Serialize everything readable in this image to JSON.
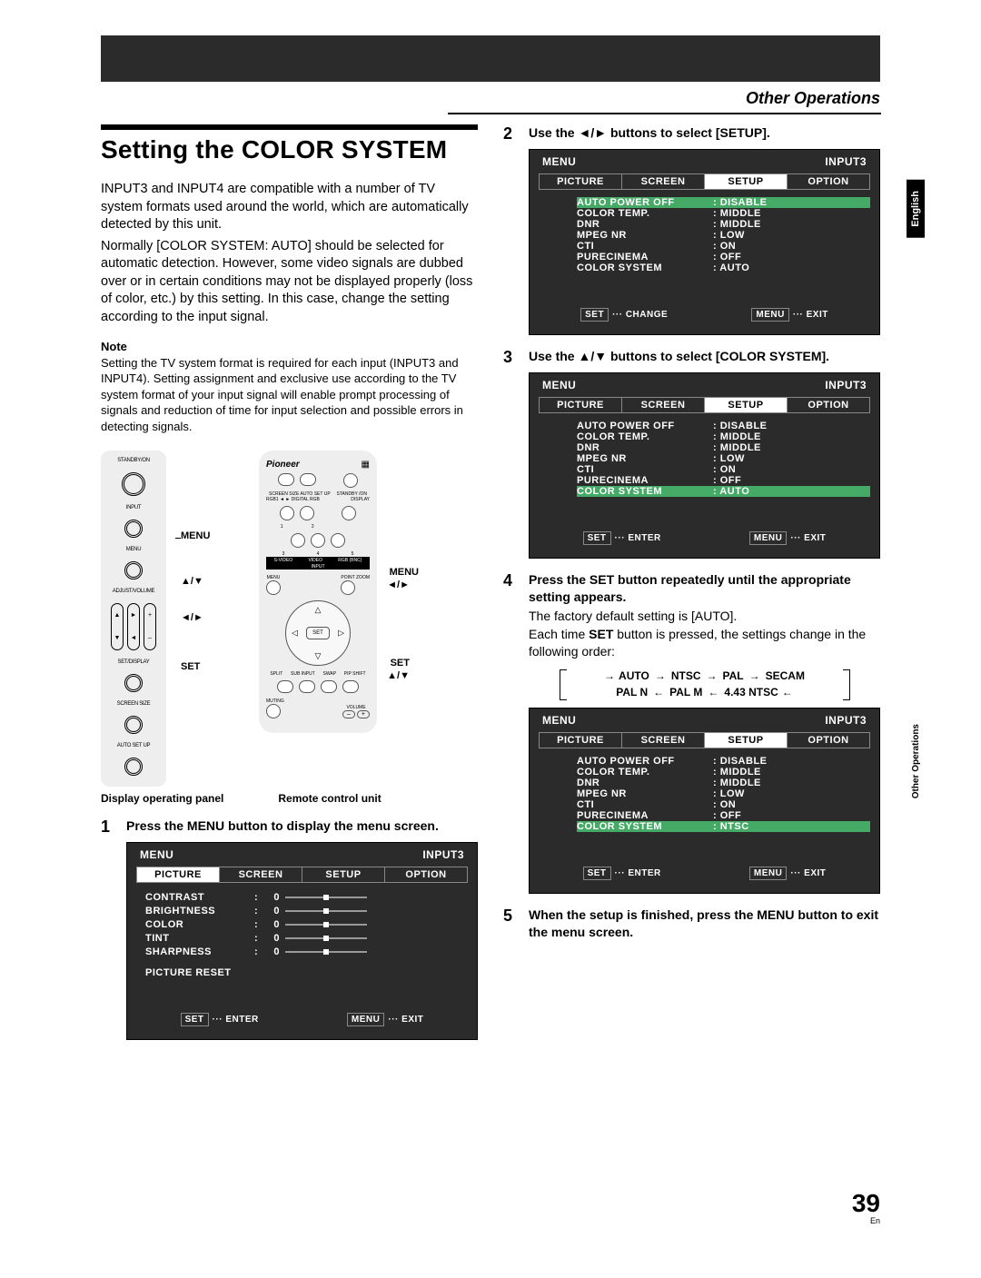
{
  "section_header": "Other Operations",
  "title": "Setting the COLOR SYSTEM",
  "intro1": "INPUT3 and INPUT4 are compatible with a number of TV system formats used around the world, which are automatically detected by this unit.",
  "intro2": "Normally [COLOR SYSTEM: AUTO] should be selected for automatic detection. However, some video signals are dubbed over or in certain conditions may not be displayed properly (loss of color, etc.) by this setting. In this case, change the setting according to the input signal.",
  "note_head": "Note",
  "note_body": "Setting the TV system format is required for each input (INPUT3 and INPUT4). Setting assignment and exclusive use according to the TV system format of your input signal will enable prompt processing of signals and reduction of time for input selection and possible errors in detecting signals.",
  "fig_caption_left": "Display operating panel",
  "fig_caption_right": "Remote control unit",
  "panel_labels": {
    "standby": "STANDBY/ON",
    "input": "INPUT",
    "menu": "MENU",
    "adjust": "ADJUST/VOLUME",
    "setdisplay": "SET/DISPLAY",
    "screen": "SCREEN SIZE",
    "autosetup": "AUTO SET UP"
  },
  "callouts": {
    "menu": "MENU",
    "updown": "▲/▼",
    "leftright": "◄/►",
    "set": "SET"
  },
  "remote": {
    "brand": "Pioneer",
    "row1": [
      "SCREEN SIZE",
      "AUTO SET UP",
      "",
      "STANDBY /ON"
    ],
    "row2_left": "RGB1 ◄ ► DIGITAL RGB",
    "row2_right": "DISPLAY",
    "nums1": [
      "1",
      "2"
    ],
    "row_inputs": [
      "S-VIDEO",
      "VIDEO",
      "RGB (BNC)"
    ],
    "nums2": [
      "3",
      "4",
      "5"
    ],
    "input_label": "INPUT",
    "menu": "MENU",
    "pointzoom": "POINT ZOOM",
    "set": "SET",
    "row_bottom": [
      "SPLIT",
      "SUB INPUT",
      "SWAP",
      "PIP SHIFT"
    ],
    "muting": "MUTING",
    "volume": "VOLUME",
    "vol_minus": "–",
    "vol_plus": "+"
  },
  "rocker_symbols": {
    "up": "▲",
    "down": "▼",
    "right": "►",
    "left": "◄",
    "plus": "+",
    "minus": "–"
  },
  "step1": {
    "head": "Press the MENU button to display the menu screen.",
    "osd": {
      "title_left": "MENU",
      "title_right": "INPUT3",
      "tabs": [
        "PICTURE",
        "SCREEN",
        "SETUP",
        "OPTION"
      ],
      "active_tab": 0,
      "rows": [
        {
          "label": "CONTRAST",
          "value": "0"
        },
        {
          "label": "BRIGHTNESS",
          "value": "0"
        },
        {
          "label": "COLOR",
          "value": "0"
        },
        {
          "label": "TINT",
          "value": "0"
        },
        {
          "label": "SHARPNESS",
          "value": "0"
        }
      ],
      "reset": "PICTURE RESET",
      "footer_left_btn": "SET",
      "footer_left_txt": "··· ENTER",
      "footer_right_btn": "MENU",
      "footer_right_txt": "··· EXIT"
    }
  },
  "step2": {
    "head": "Use the ◄/► buttons to select [SETUP].",
    "osd": {
      "title_left": "MENU",
      "title_right": "INPUT3",
      "tabs": [
        "PICTURE",
        "SCREEN",
        "SETUP",
        "OPTION"
      ],
      "active_tab": 2,
      "rows": [
        {
          "label": "AUTO POWER OFF",
          "value": ": DISABLE",
          "hi": true
        },
        {
          "label": "COLOR TEMP.",
          "value": ": MIDDLE"
        },
        {
          "label": "DNR",
          "value": ": MIDDLE"
        },
        {
          "label": "MPEG NR",
          "value": ": LOW"
        },
        {
          "label": "CTI",
          "value": ": ON"
        },
        {
          "label": "PURECINEMA",
          "value": ": OFF"
        },
        {
          "label": "COLOR SYSTEM",
          "value": ": AUTO"
        }
      ],
      "footer_left_btn": "SET",
      "footer_left_txt": "··· CHANGE",
      "footer_right_btn": "MENU",
      "footer_right_txt": "··· EXIT"
    }
  },
  "step3": {
    "head": "Use the ▲/▼ buttons to select [COLOR SYSTEM].",
    "osd": {
      "title_left": "MENU",
      "title_right": "INPUT3",
      "tabs": [
        "PICTURE",
        "SCREEN",
        "SETUP",
        "OPTION"
      ],
      "active_tab": 2,
      "rows": [
        {
          "label": "AUTO POWER OFF",
          "value": ": DISABLE"
        },
        {
          "label": "COLOR TEMP.",
          "value": ": MIDDLE"
        },
        {
          "label": "DNR",
          "value": ": MIDDLE"
        },
        {
          "label": "MPEG NR",
          "value": ": LOW"
        },
        {
          "label": "CTI",
          "value": ": ON"
        },
        {
          "label": "PURECINEMA",
          "value": ": OFF"
        },
        {
          "label": "COLOR SYSTEM",
          "value": ": AUTO",
          "hi": true
        }
      ],
      "footer_left_btn": "SET",
      "footer_left_txt": "··· ENTER",
      "footer_right_btn": "MENU",
      "footer_right_txt": "··· EXIT"
    }
  },
  "step4": {
    "head": "Press the SET button repeatedly until the appropriate setting appears.",
    "sub1": "The factory default setting is [AUTO].",
    "sub2_a": "Each time ",
    "sub2_b": "SET",
    "sub2_c": " button is pressed, the settings change in the following order:",
    "cycle_top": [
      "AUTO",
      "NTSC",
      "PAL",
      "SECAM"
    ],
    "cycle_bottom": [
      "PAL N",
      "PAL M",
      "4.43 NTSC"
    ],
    "osd": {
      "title_left": "MENU",
      "title_right": "INPUT3",
      "tabs": [
        "PICTURE",
        "SCREEN",
        "SETUP",
        "OPTION"
      ],
      "active_tab": 2,
      "rows": [
        {
          "label": "AUTO POWER OFF",
          "value": ": DISABLE"
        },
        {
          "label": "COLOR TEMP.",
          "value": ": MIDDLE"
        },
        {
          "label": "DNR",
          "value": ": MIDDLE"
        },
        {
          "label": "MPEG NR",
          "value": ": LOW"
        },
        {
          "label": "CTI",
          "value": ": ON"
        },
        {
          "label": "PURECINEMA",
          "value": ": OFF"
        },
        {
          "label": "COLOR SYSTEM",
          "value": ": NTSC",
          "hi": true
        }
      ],
      "footer_left_btn": "SET",
      "footer_left_txt": "··· ENTER",
      "footer_right_btn": "MENU",
      "footer_right_txt": "··· EXIT"
    }
  },
  "step5": {
    "head": "When the setup is finished, press the MENU button to exit the menu screen."
  },
  "side_english": "English",
  "side_ops": "Other Operations",
  "page_number": "39",
  "page_lang": "En"
}
